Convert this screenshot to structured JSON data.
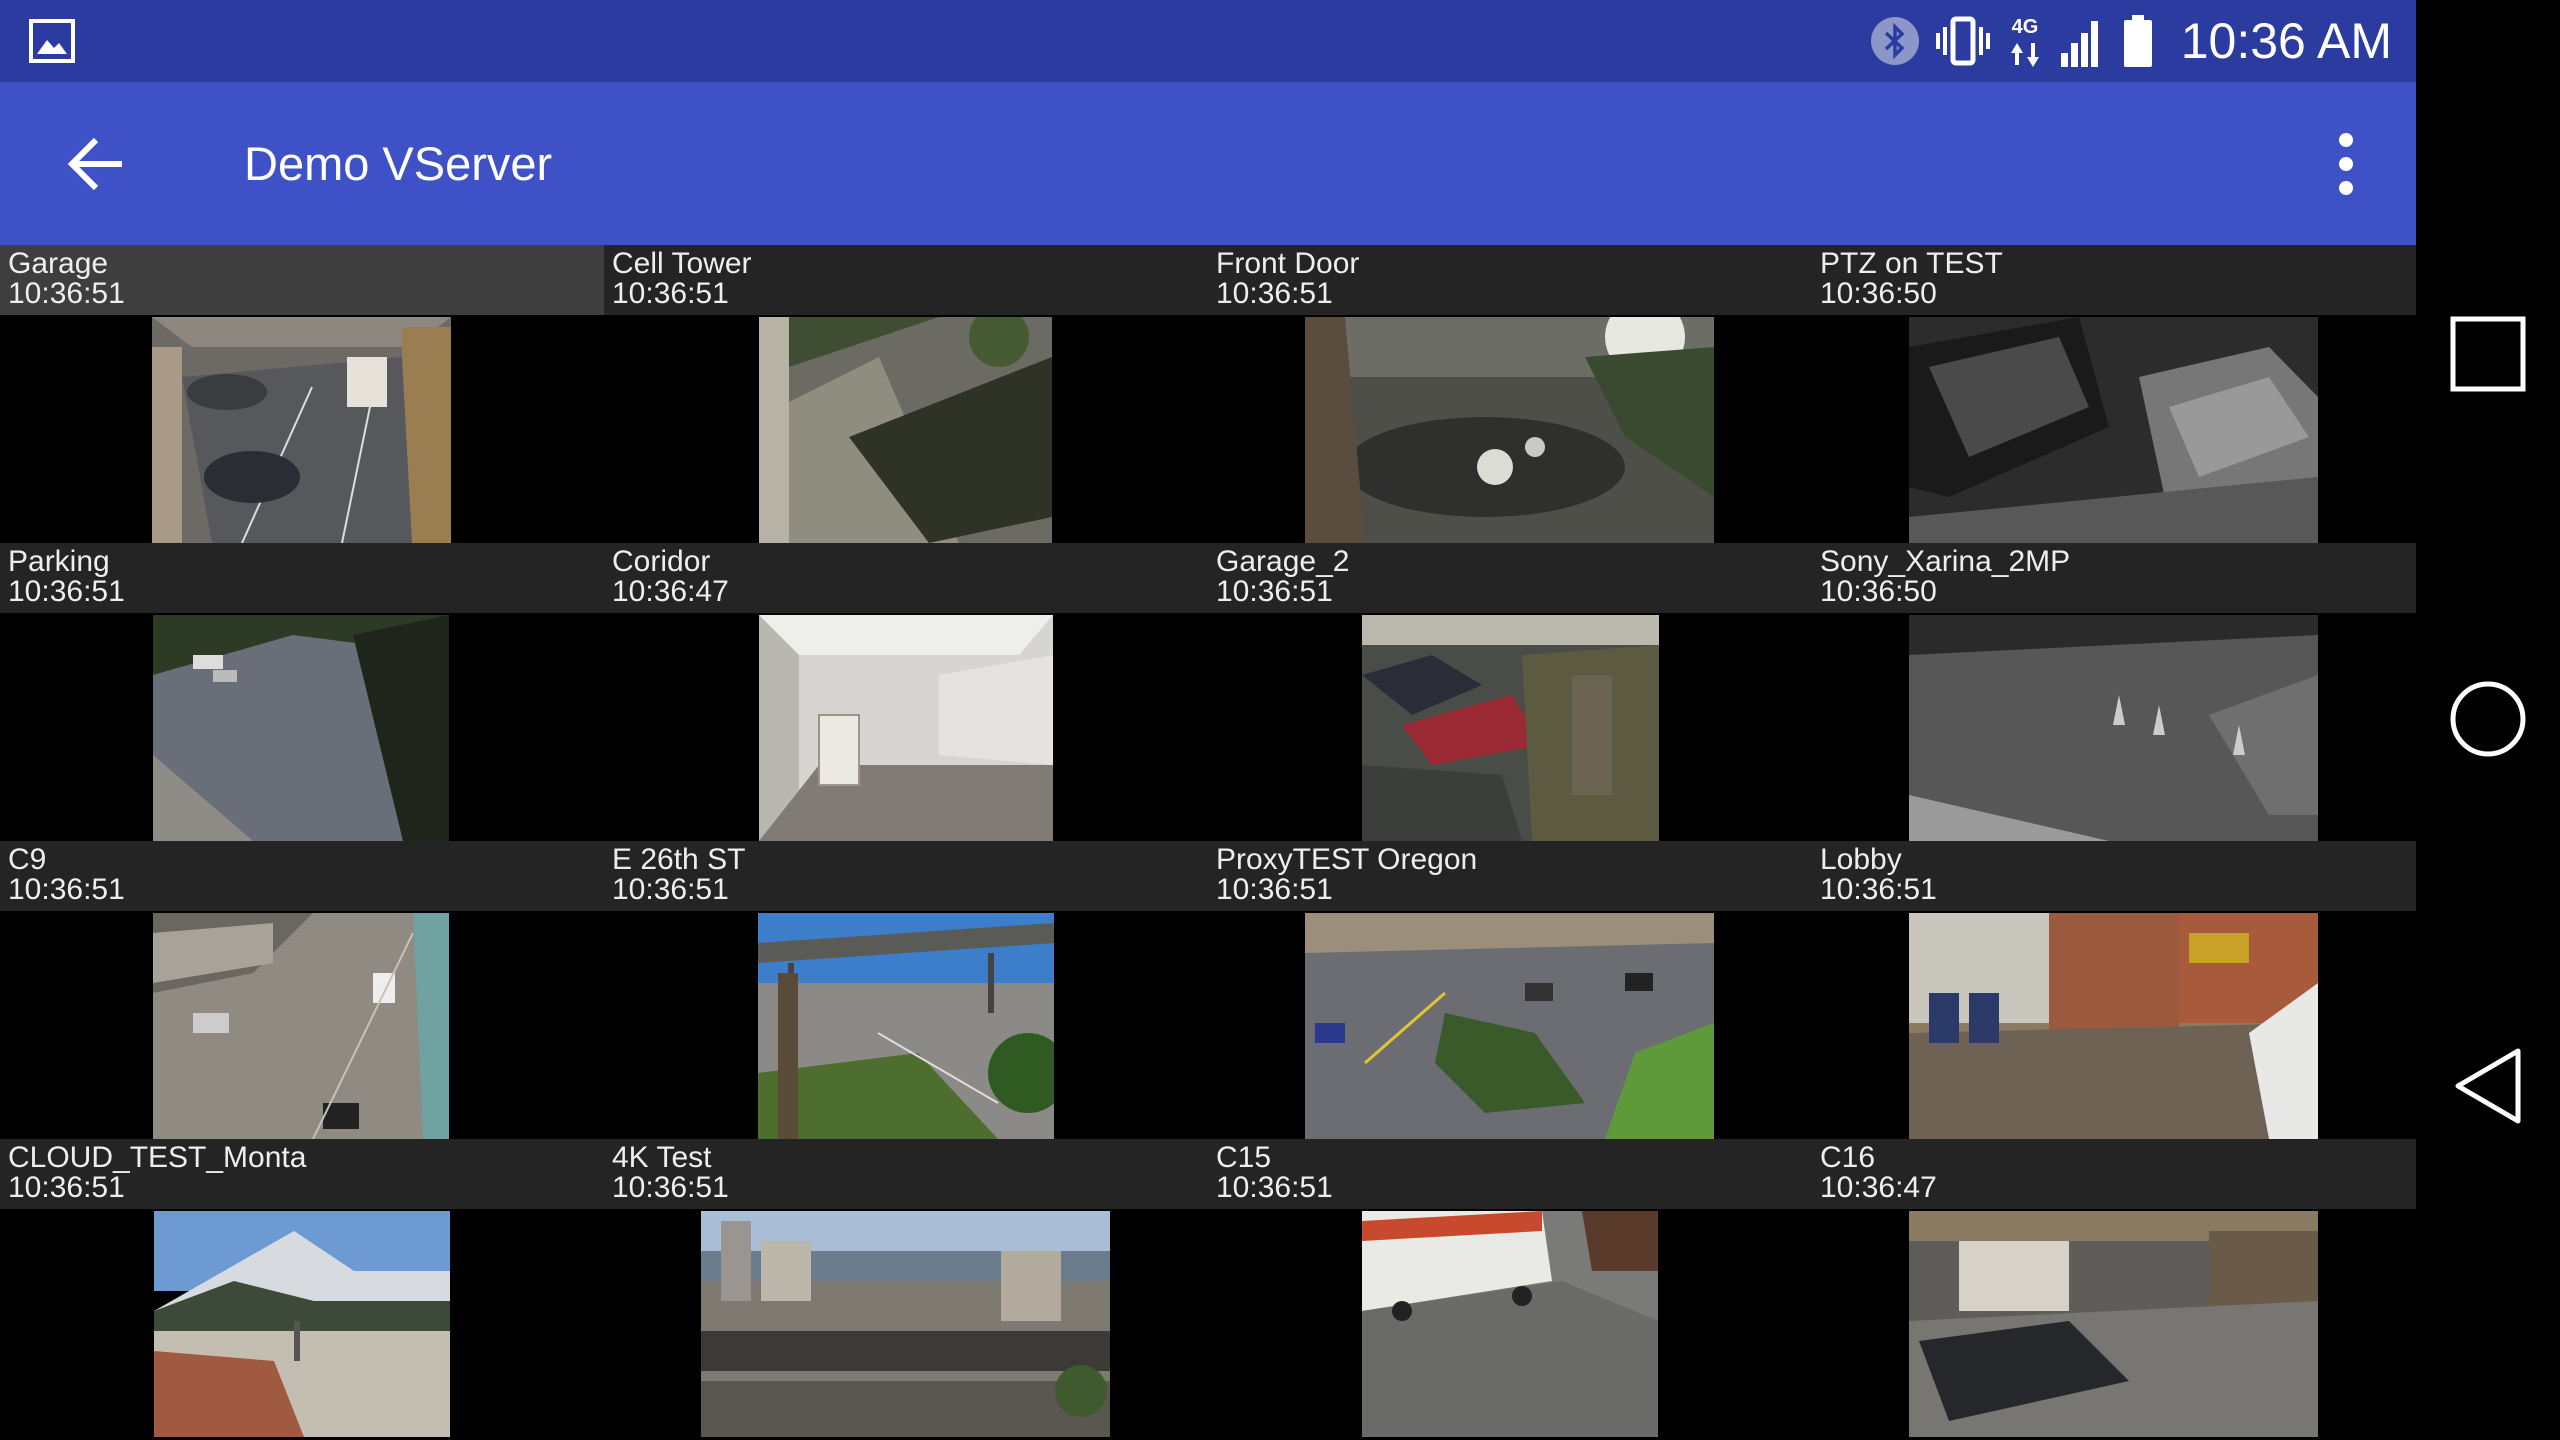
{
  "status_bar": {
    "time": "10:36 AM",
    "icons": [
      "gallery-icon",
      "bluetooth-icon",
      "vibrate-icon",
      "4g-lte-icon",
      "signal-icon",
      "battery-icon"
    ],
    "network_label": "4G"
  },
  "app_bar": {
    "title": "Demo VServer",
    "back_icon": "arrow-left-icon",
    "menu_icon": "more-vert-icon"
  },
  "colors": {
    "status_bar": "#2b3b9f",
    "app_bar": "#3f51c6",
    "label_bg": "#242424",
    "selected_label_bg": "#3e3e3e"
  },
  "cameras": [
    {
      "name": "Garage",
      "time": "10:36:51",
      "selected": true
    },
    {
      "name": "Cell Tower",
      "time": "10:36:51"
    },
    {
      "name": "Front Door",
      "time": "10:36:51"
    },
    {
      "name": "PTZ on TEST",
      "time": "10:36:50"
    },
    {
      "name": "Parking",
      "time": "10:36:51"
    },
    {
      "name": "Coridor",
      "time": "10:36:47"
    },
    {
      "name": "Garage_2",
      "time": "10:36:51"
    },
    {
      "name": "Sony_Xarina_2MP",
      "time": "10:36:50"
    },
    {
      "name": "C9",
      "time": "10:36:51"
    },
    {
      "name": "E 26th ST",
      "time": "10:36:51"
    },
    {
      "name": "ProxyTEST Oregon",
      "time": "10:36:51"
    },
    {
      "name": "Lobby",
      "time": "10:36:51"
    },
    {
      "name": "CLOUD_TEST_Monta",
      "time": "10:36:51"
    },
    {
      "name": "4K Test",
      "time": "10:36:51"
    },
    {
      "name": "C15",
      "time": "10:36:51"
    },
    {
      "name": "C16",
      "time": "10:36:47"
    }
  ],
  "nav_bar": {
    "recents_icon": "recents-square-icon",
    "home_icon": "home-circle-icon",
    "back_icon": "back-triangle-icon"
  }
}
